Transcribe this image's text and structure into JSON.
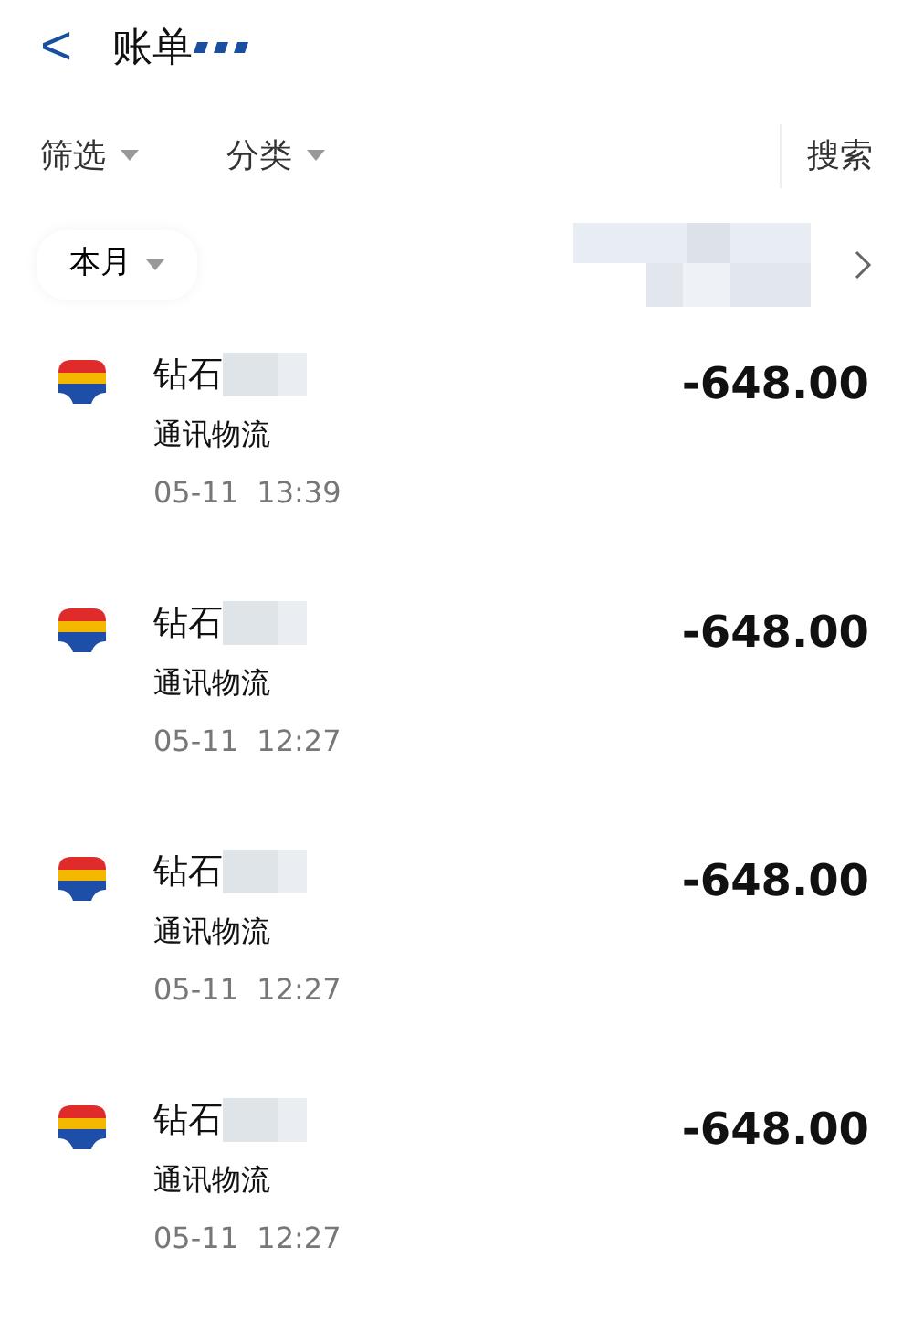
{
  "header": {
    "back": "<",
    "title": "账单"
  },
  "filters": [
    {
      "label": "筛选"
    },
    {
      "label": "分类"
    }
  ],
  "search": "搜索",
  "period": {
    "label": "本月"
  },
  "transactions": [
    {
      "name": "钻石",
      "category": "通讯物流",
      "date": "05-11",
      "time": "13:39",
      "amount": "-648.00"
    },
    {
      "name": "钻石",
      "category": "通讯物流",
      "date": "05-11",
      "time": "12:27",
      "amount": "-648.00"
    },
    {
      "name": "钻石",
      "category": "通讯物流",
      "date": "05-11",
      "time": "12:27",
      "amount": "-648.00"
    },
    {
      "name": "钻石",
      "category": "通讯物流",
      "date": "05-11",
      "time": "12:27",
      "amount": "-648.00"
    }
  ]
}
